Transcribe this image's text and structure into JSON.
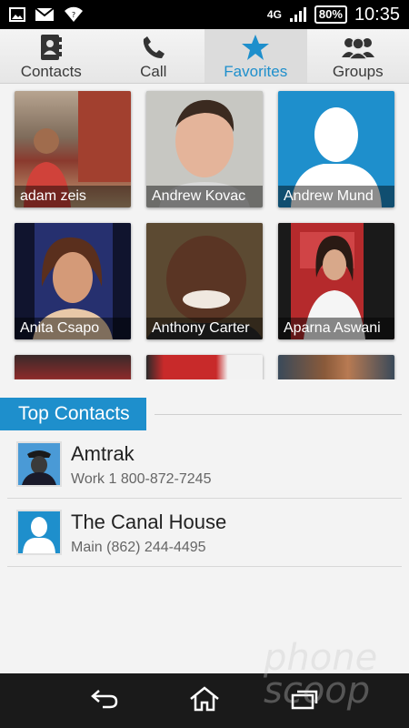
{
  "status_bar": {
    "network": "4G",
    "battery": "80%",
    "time": "10:35",
    "icons": [
      "image-icon",
      "gmail-icon",
      "wifi-icon",
      "signal-icon",
      "battery-icon"
    ]
  },
  "tabs": [
    {
      "label": "Contacts",
      "icon": "contacts-book-icon",
      "active": false
    },
    {
      "label": "Call",
      "icon": "phone-icon",
      "active": false
    },
    {
      "label": "Favorites",
      "icon": "star-icon",
      "active": true
    },
    {
      "label": "Groups",
      "icon": "group-icon",
      "active": false
    }
  ],
  "favorites": [
    {
      "name": "adam zeis"
    },
    {
      "name": "Andrew Kovac"
    },
    {
      "name": "Andrew Mund"
    },
    {
      "name": "Anita Csapo"
    },
    {
      "name": "Anthony Carter"
    },
    {
      "name": "Aparna Aswani"
    }
  ],
  "top_contacts": {
    "title": "Top Contacts",
    "items": [
      {
        "name": "Amtrak",
        "detail": "Work 1 800-872-7245"
      },
      {
        "name": "The Canal House",
        "detail": "Main (862) 244-4495"
      }
    ]
  },
  "colors": {
    "accent": "#1e8fcc",
    "status_bar": "#000000",
    "nav_bar": "#1a1a1a"
  },
  "nav": [
    "back-icon",
    "home-icon",
    "recents-icon"
  ]
}
